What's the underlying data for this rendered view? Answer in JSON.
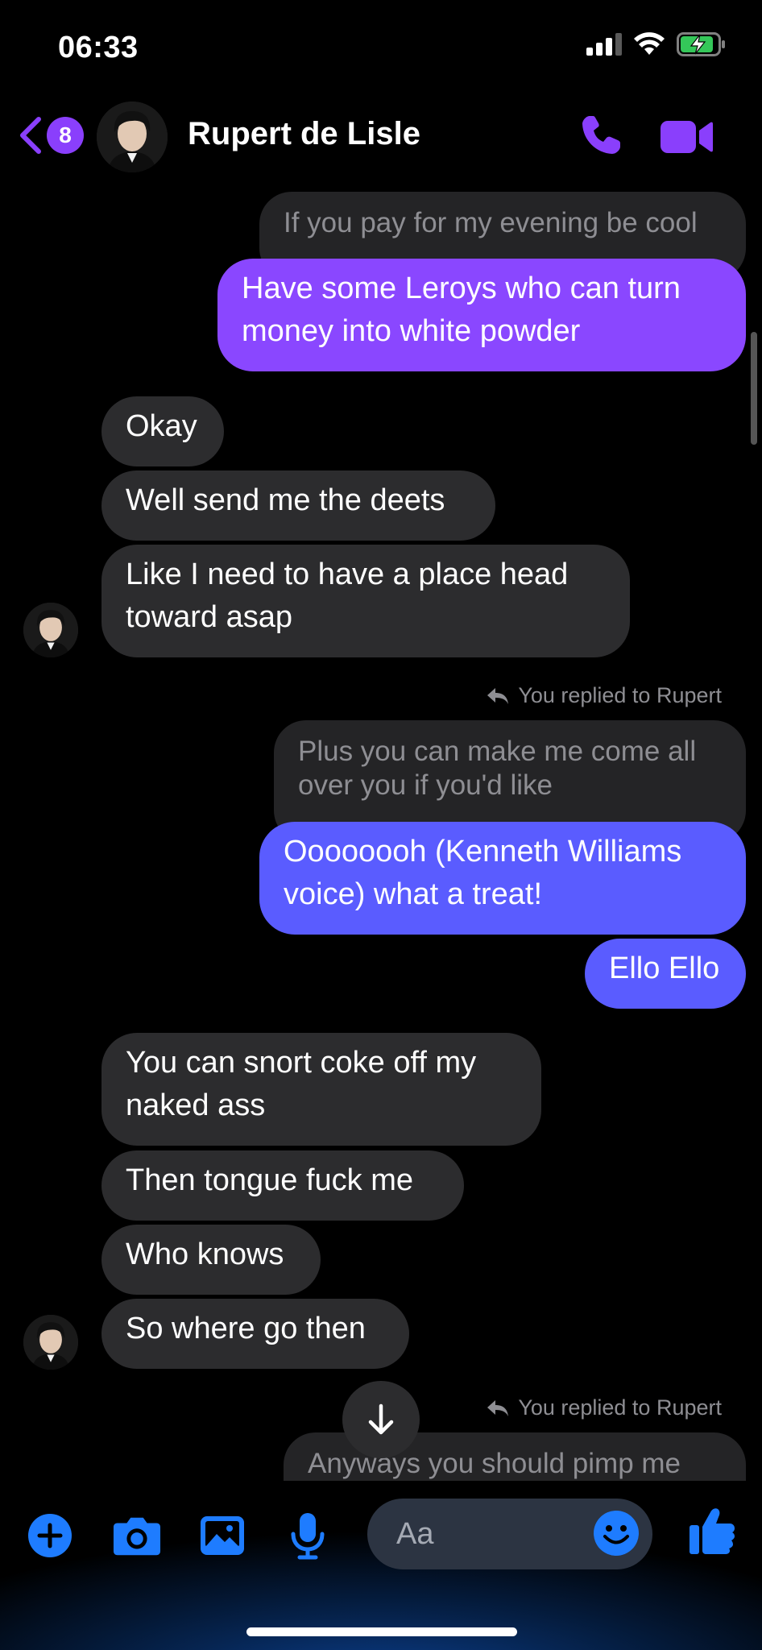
{
  "status": {
    "time": "06:33"
  },
  "header": {
    "badge_count": "8",
    "contact_name": "Rupert de Lisle"
  },
  "messages": {
    "m1_quote": "If you pay for my evening be cool",
    "m2": "Have some Leroys who can turn money into white powder",
    "m3": "Okay",
    "m4": "Well send me the deets",
    "m5": "Like I need to have a place head toward asap",
    "reply1": "You replied to Rupert",
    "m6_quote": "Plus you can make me come all over you if you'd like",
    "m7": "Oooooooh (Kenneth Williams voice) what a treat!",
    "m8": "Ello Ello",
    "m9": "You can snort coke off my naked ass",
    "m10": "Then tongue fuck me",
    "m11": "Who knows",
    "m12": "So where go then",
    "reply2": "You replied to Rupert",
    "m13_quote": "Anyways you should pimp me"
  },
  "composer": {
    "placeholder": "Aa"
  },
  "colors": {
    "accent": "#8a3ffc",
    "outgoing_purple": "#8a47ff",
    "outgoing_blue": "#5a5cff",
    "incoming": "#2c2c2e",
    "composer_icons": "#1e7cff"
  }
}
